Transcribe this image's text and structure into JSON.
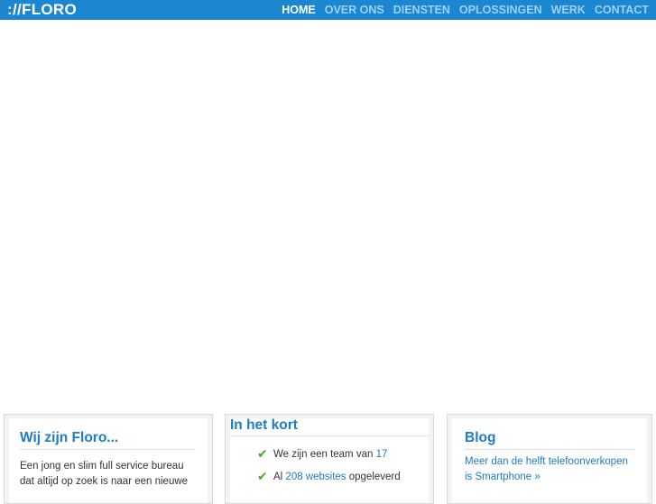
{
  "header": {
    "logo": "://FLORO",
    "nav": [
      {
        "label": "HOME",
        "active": true
      },
      {
        "label": "OVER ONS",
        "active": false
      },
      {
        "label": "DIENSTEN",
        "active": false
      },
      {
        "label": "OPLOSSINGEN",
        "active": false
      },
      {
        "label": "WERK",
        "active": false
      },
      {
        "label": "CONTACT",
        "active": false
      }
    ]
  },
  "panels": {
    "about": {
      "title": "Wij zijn Floro...",
      "body": "Een jong en slim full service bureau dat altijd op zoek is naar een nieuwe"
    },
    "summary": {
      "title": "In het kort",
      "items": [
        {
          "prefix": "We zijn een team van ",
          "highlight": "17",
          "suffix": ""
        },
        {
          "prefix": "Al ",
          "highlight": "208 websites",
          "suffix": " opgeleverd"
        }
      ]
    },
    "blog": {
      "title": "Blog",
      "post": "Meer dan de helft telefoonverkopen is Smartphone »"
    }
  },
  "colors": {
    "brand": "#1c87d0",
    "link": "#1c7cc4",
    "check": "#52a52c"
  },
  "icons": {
    "check": "check-icon"
  }
}
